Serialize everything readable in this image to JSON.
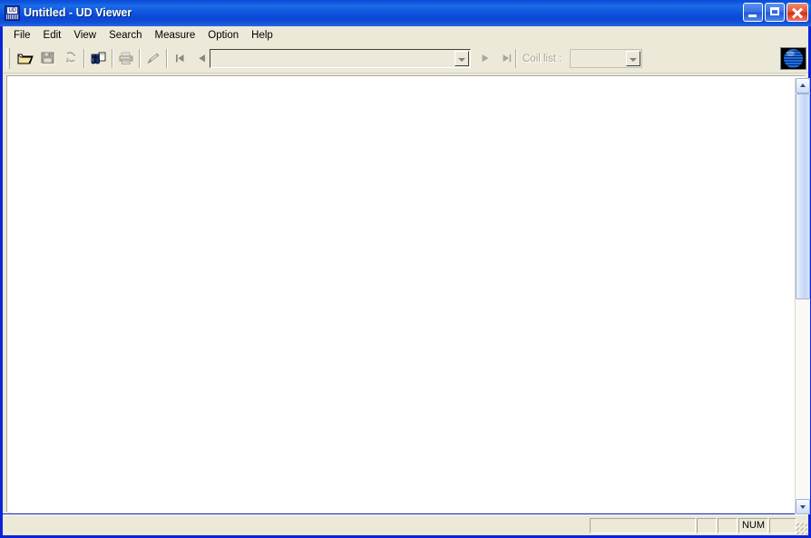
{
  "window": {
    "title_main": "Untitled",
    "title_sep": " - ",
    "title_app": "UD Viewer",
    "icon_name": "ud-app-icon",
    "icon_text": "UD",
    "buttons": {
      "minimize": "Minimize",
      "maximize": "Maximize",
      "close": "Close"
    },
    "accent_titlebar": "#0b46d6",
    "accent_close": "#d22f18",
    "face_color": "#ece9d8"
  },
  "menubar": {
    "items": [
      {
        "label": "File"
      },
      {
        "label": "Edit"
      },
      {
        "label": "View"
      },
      {
        "label": "Search"
      },
      {
        "label": "Measure"
      },
      {
        "label": "Option"
      },
      {
        "label": "Help"
      }
    ]
  },
  "toolbar": {
    "buttons": [
      {
        "name": "open-file-button",
        "icon": "open-folder-icon",
        "enabled": true,
        "tooltip": "Open"
      },
      {
        "name": "save-file-button",
        "icon": "floppy-disk-icon",
        "enabled": false,
        "tooltip": "Save"
      },
      {
        "name": "refresh-button",
        "icon": "refresh-arrows-icon",
        "enabled": false,
        "tooltip": "Refresh"
      },
      {
        "name": "find-button",
        "icon": "binoculars-icon",
        "enabled": true,
        "tooltip": "Find"
      },
      {
        "name": "print-button",
        "icon": "printer-icon",
        "enabled": false,
        "tooltip": "Print"
      },
      {
        "name": "edit-pen-button",
        "icon": "pencil-icon",
        "enabled": false,
        "tooltip": "Edit"
      },
      {
        "name": "first-record-button",
        "icon": "skip-first-icon",
        "enabled": false,
        "tooltip": "First"
      },
      {
        "name": "prev-record-button",
        "icon": "play-prev-icon",
        "enabled": false,
        "tooltip": "Previous"
      }
    ],
    "record_combo": {
      "name": "record-combo",
      "value": "",
      "placeholder": ""
    },
    "nav_after": [
      {
        "name": "next-record-button",
        "icon": "play-next-icon",
        "enabled": false,
        "tooltip": "Next"
      },
      {
        "name": "last-record-button",
        "icon": "skip-last-icon",
        "enabled": false,
        "tooltip": "Last"
      }
    ],
    "coil_list": {
      "label": "Coil list :",
      "value": "",
      "enabled": false
    },
    "logo": {
      "name": "company-globe-logo",
      "color": "#1e6fe0"
    }
  },
  "client": {
    "content": "",
    "background": "#ffffff",
    "vscroll": {
      "up_label": "Scroll up",
      "down_label": "Scroll down",
      "thumb_label": "Scroll thumb"
    }
  },
  "statusbar": {
    "message": "",
    "panes": [
      {
        "name": "status-pane-info",
        "text": ""
      },
      {
        "name": "status-pane-a",
        "text": ""
      },
      {
        "name": "status-pane-b",
        "text": ""
      },
      {
        "name": "status-pane-num",
        "text": "NUM"
      },
      {
        "name": "status-pane-c",
        "text": ""
      }
    ]
  }
}
